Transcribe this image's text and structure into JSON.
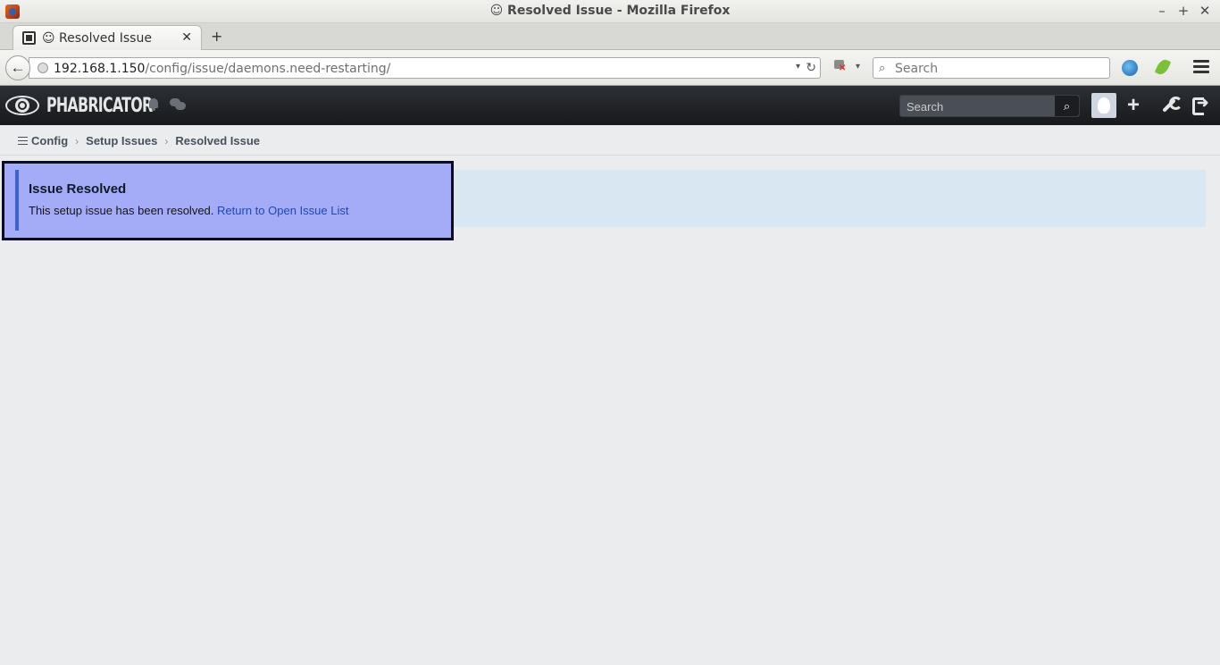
{
  "window": {
    "title": "☺ Resolved Issue - Mozilla Firefox",
    "controls": {
      "minimize": "–",
      "maximize": "+",
      "close": "✕"
    }
  },
  "browser": {
    "tab": {
      "label": "☺ Resolved Issue",
      "close": "✕"
    },
    "new_tab": "+",
    "url": {
      "host": "192.168.1.150",
      "path": "/config/issue/daemons.need-restarting/"
    },
    "search_placeholder": "Search",
    "back": "←",
    "reload": "↻",
    "dropdown": "▾"
  },
  "header": {
    "logo_text": "PHABRICATOR",
    "search_placeholder": "Search",
    "search_button": "⌕",
    "plus": "+"
  },
  "breadcrumb": {
    "items": [
      "Config",
      "Setup Issues",
      "Resolved Issue"
    ],
    "separator": "›"
  },
  "notice": {
    "title": "Issue Resolved",
    "text": "This setup issue has been resolved.",
    "link": "Return to Open Issue List"
  },
  "colors": {
    "header_bg": "#1f2226",
    "notice_bg": "#a5acf7",
    "notice_accent": "#3e63c9",
    "link": "#1d47b5",
    "page_bg": "#ebecee"
  }
}
